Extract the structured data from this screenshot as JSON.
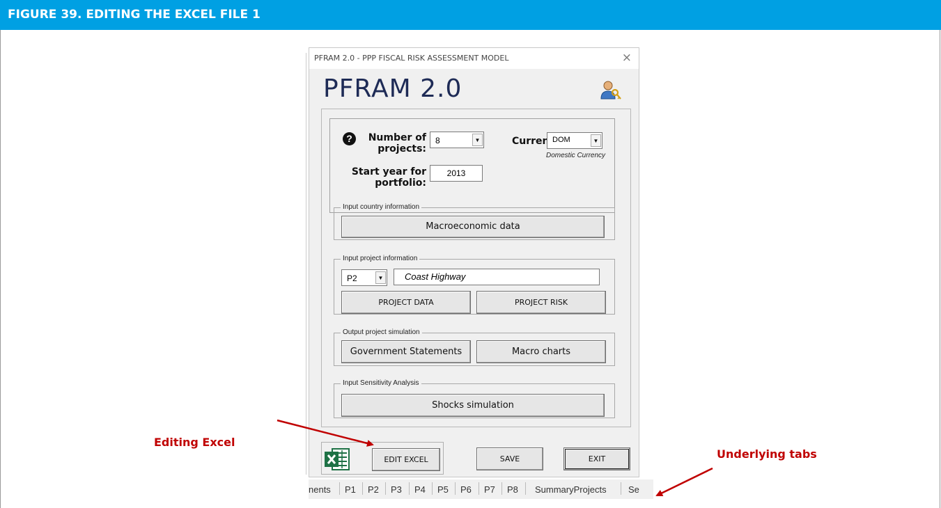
{
  "figure": {
    "title": "FIGURE 39.  EDITING THE EXCEL FILE 1"
  },
  "window": {
    "title": "PFRAM 2.0 - PPP FISCAL RISK ASSESSMENT MODEL",
    "close": "×",
    "app_title": "PFRAM 2.0"
  },
  "settings": {
    "help_icon": "?",
    "num_projects_label": "Number of projects:",
    "num_projects_value": "8",
    "currency_label": "Currency:",
    "currency_value": "DOM",
    "currency_note": "Domestic Currency",
    "start_year_label": "Start year for portfolio:",
    "start_year_value": "2013"
  },
  "country": {
    "group_label": "Input country information",
    "macro_button": "Macroeconomic data"
  },
  "project": {
    "group_label": "Input project information",
    "selected_project": "P2",
    "project_name": "Coast Highway",
    "data_button": "PROJECT DATA",
    "risk_button": "PROJECT RISK"
  },
  "output": {
    "group_label": "Output project simulation",
    "gov_button": "Government Statements",
    "charts_button": "Macro charts"
  },
  "sensitivity": {
    "group_label": "Input Sensitivity Analysis",
    "shocks_button": "Shocks simulation"
  },
  "footer": {
    "edit_button": "EDIT EXCEL",
    "save_button": "SAVE",
    "exit_button": "EXIT"
  },
  "sheet_tabs": [
    "nents",
    "P1",
    "P2",
    "P3",
    "P4",
    "P5",
    "P6",
    "P7",
    "P8",
    "SummaryProjects",
    "Se"
  ],
  "callouts": {
    "editing_excel": "Editing Excel",
    "underlying_tabs": "Underlying tabs"
  },
  "colors": {
    "header_blue": "#00a0e3",
    "callout_red": "#c00000",
    "title_navy": "#1e2b56",
    "excel_green": "#1e7145"
  },
  "icons": [
    "help-icon",
    "user-key-icon",
    "excel-logo-icon",
    "dropdown-arrow-icon",
    "close-icon"
  ]
}
